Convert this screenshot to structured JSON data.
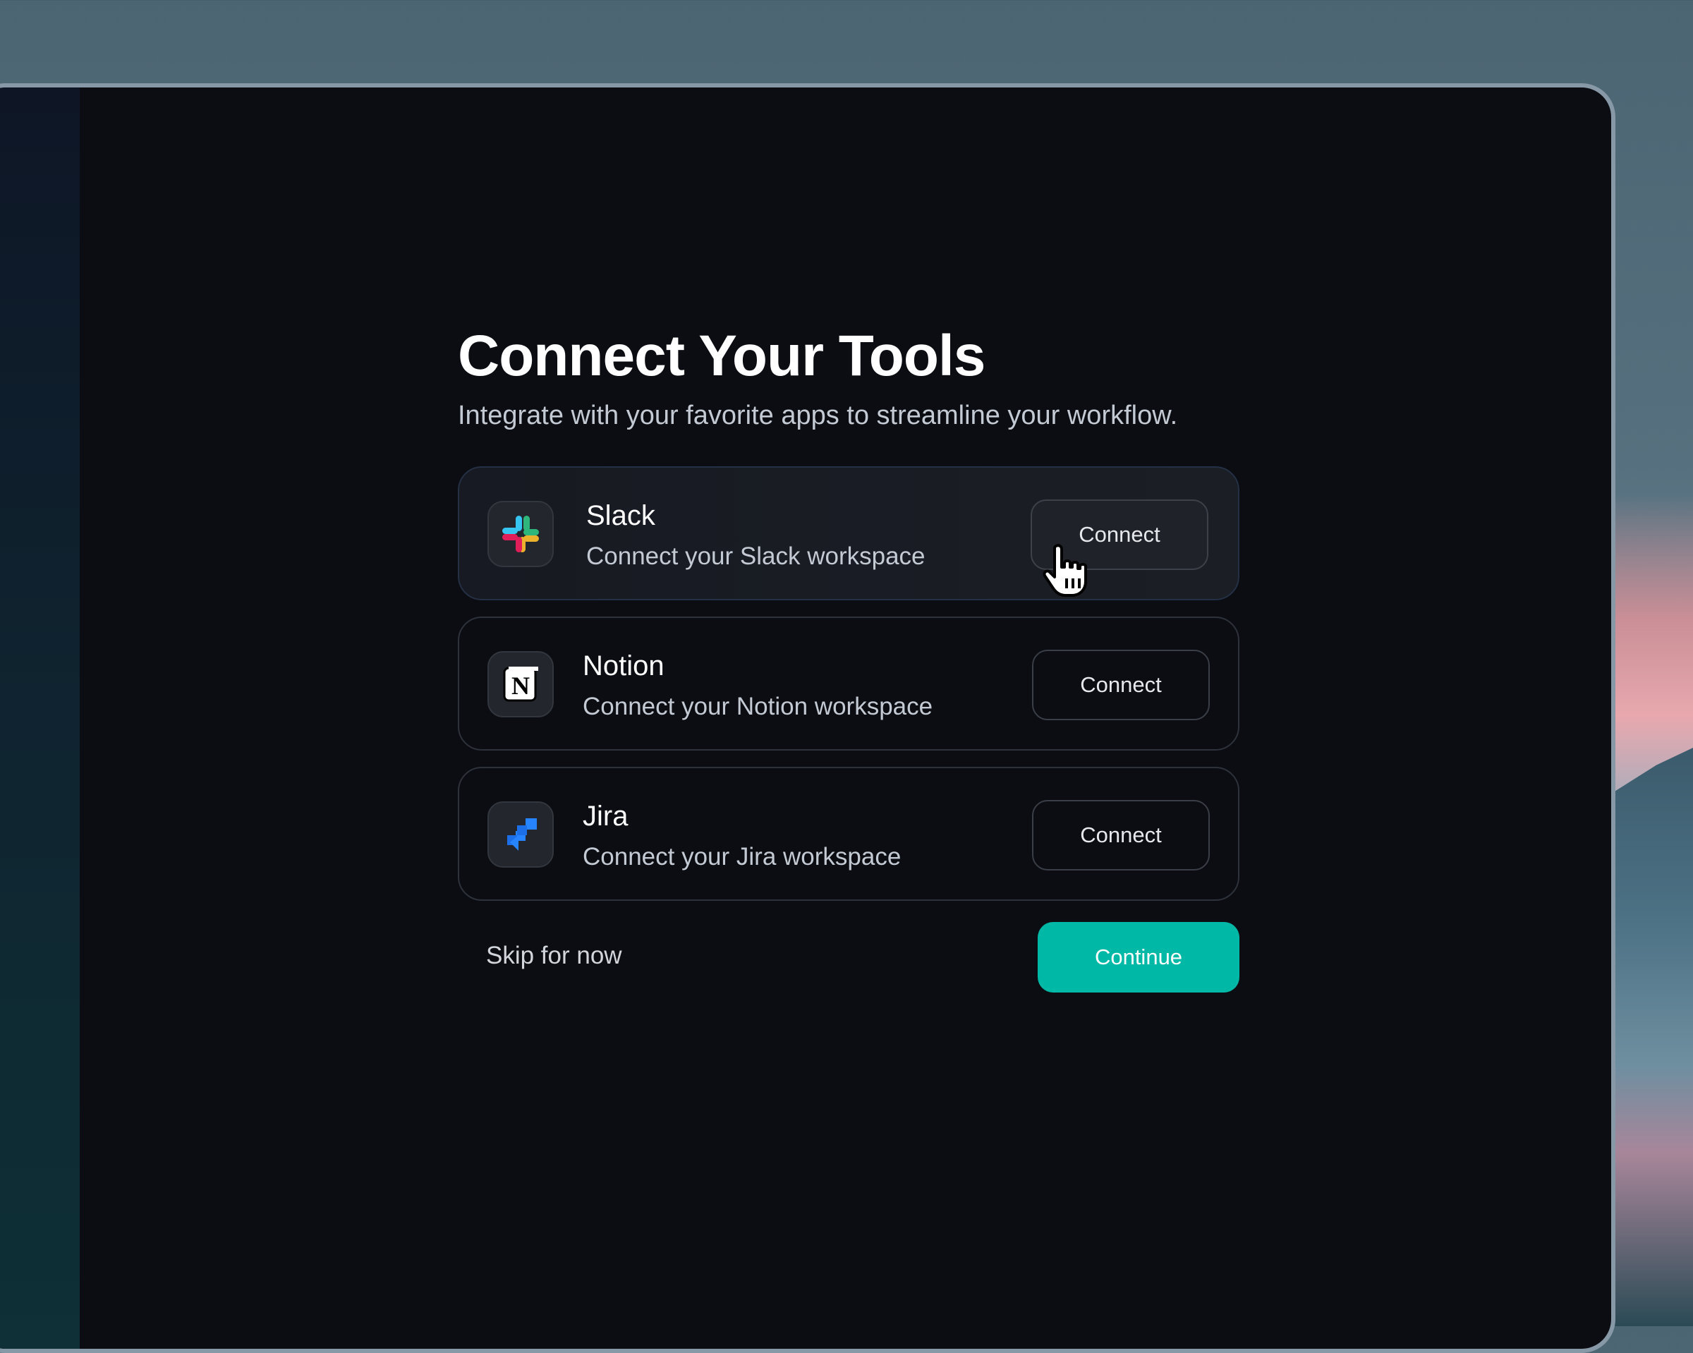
{
  "onboarding": {
    "title": "Connect Your Tools",
    "subtitle": "Integrate with your favorite apps to streamline your workflow."
  },
  "integrations": [
    {
      "name": "Slack",
      "description": "Connect your Slack workspace",
      "button": "Connect",
      "icon": "slack-icon"
    },
    {
      "name": "Notion",
      "description": "Connect your Notion workspace",
      "button": "Connect",
      "icon": "notion-icon"
    },
    {
      "name": "Jira",
      "description": "Connect your Jira workspace",
      "button": "Connect",
      "icon": "jira-icon"
    }
  ],
  "actions": {
    "skip_label": "Skip for now",
    "continue_label": "Continue"
  },
  "colors": {
    "accent": "#00b8a6",
    "window_bg": "#0b0d12"
  }
}
